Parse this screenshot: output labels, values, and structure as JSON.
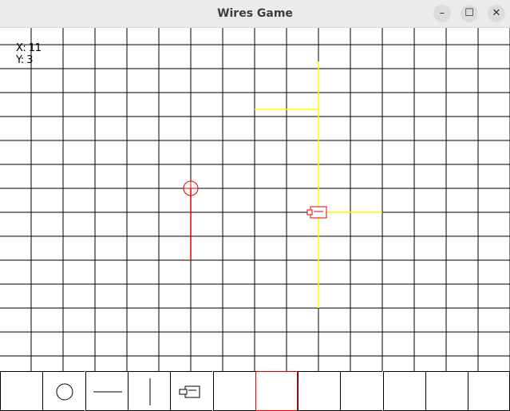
{
  "window": {
    "title": "Wires Game",
    "buttons": {
      "minimize": "–",
      "maximize": "☐",
      "close": "✕"
    }
  },
  "status": {
    "x_label": "X: 11",
    "y_label": "Y: 3"
  },
  "grid": {
    "columns": 16,
    "rows": 15,
    "line_color": "#000000"
  },
  "board_items": [
    {
      "kind": "node",
      "col": 5,
      "row": 6,
      "color": "#e00000"
    },
    {
      "kind": "wire-vertical",
      "col": 5,
      "row_from": 6,
      "row_to": 9,
      "color": "#e00000"
    },
    {
      "kind": "wire-vertical",
      "col": 9,
      "row_from": 0.7,
      "row_to": 11,
      "color": "#ffff00"
    },
    {
      "kind": "wire-horizontal",
      "row": 2.7,
      "col_from": 7,
      "col_to": 9,
      "color": "#ffff00"
    },
    {
      "kind": "wire-horizontal",
      "row": 7,
      "col_from": 9,
      "col_to": 11,
      "color": "#ffff00"
    },
    {
      "kind": "battery",
      "col": 9,
      "row": 7,
      "color": "#e00000"
    }
  ],
  "toolbar": {
    "tools": [
      {
        "name": "empty",
        "icon": ""
      },
      {
        "name": "node",
        "icon": "circle-icon"
      },
      {
        "name": "horizontal-wire",
        "icon": "horizontal-line-icon"
      },
      {
        "name": "vertical-wire",
        "icon": "vertical-line-icon"
      },
      {
        "name": "battery",
        "icon": "battery-icon"
      },
      {
        "name": "empty",
        "icon": ""
      },
      {
        "name": "empty",
        "icon": "",
        "selected": true
      },
      {
        "name": "empty",
        "icon": ""
      },
      {
        "name": "empty",
        "icon": ""
      },
      {
        "name": "empty",
        "icon": ""
      },
      {
        "name": "empty",
        "icon": ""
      },
      {
        "name": "empty",
        "icon": ""
      }
    ],
    "selected_color": "#e00000"
  }
}
